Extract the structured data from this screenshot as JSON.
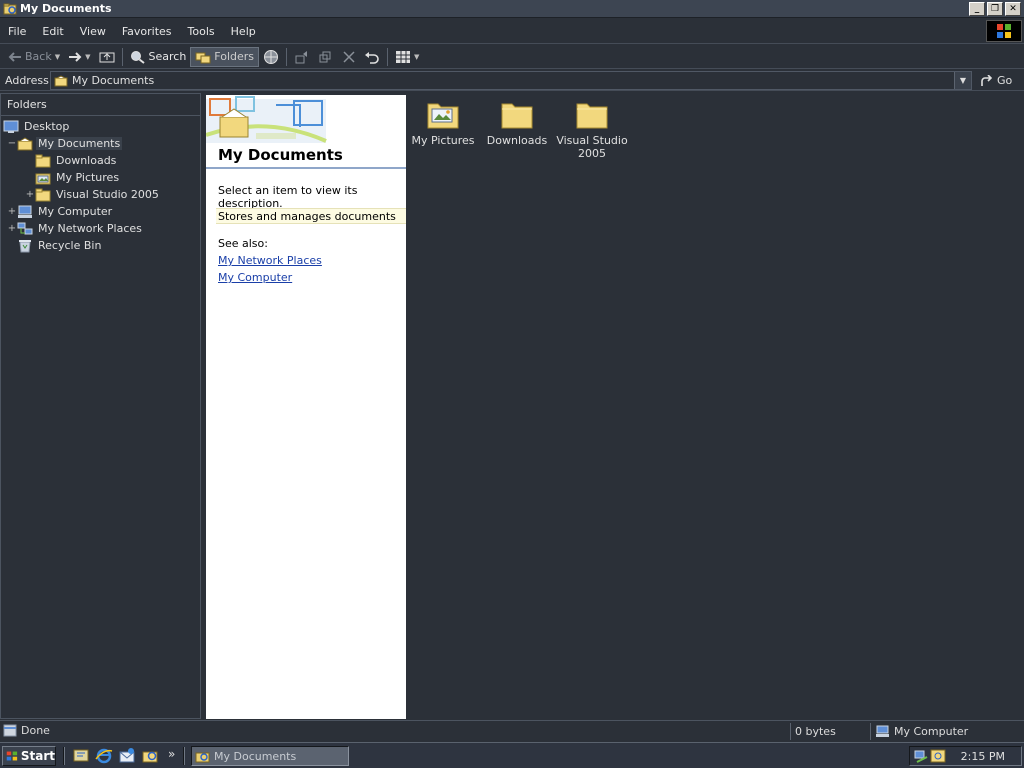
{
  "window": {
    "title": "My Documents",
    "controls": [
      "minimize",
      "restore",
      "close"
    ]
  },
  "menu": [
    "File",
    "Edit",
    "View",
    "Favorites",
    "Tools",
    "Help"
  ],
  "toolbar": {
    "back_label": "Back",
    "search_label": "Search",
    "folders_label": "Folders"
  },
  "address": {
    "label": "Address",
    "value": "My Documents",
    "go_label": "Go"
  },
  "folders_pane": {
    "header": "Folders",
    "items": [
      {
        "label": "Desktop",
        "level": 0,
        "icon": "desktop-icon",
        "expander": ""
      },
      {
        "label": "My Documents",
        "level": 1,
        "icon": "my-documents-icon",
        "expander": "−",
        "selected": true
      },
      {
        "label": "Downloads",
        "level": 2,
        "icon": "folder-icon",
        "expander": ""
      },
      {
        "label": "My Pictures",
        "level": 2,
        "icon": "pictures-folder-icon",
        "expander": ""
      },
      {
        "label": "Visual Studio 2005",
        "level": 2,
        "icon": "folder-icon",
        "expander": "+"
      },
      {
        "label": "My Computer",
        "level": 1,
        "icon": "computer-icon",
        "expander": "+"
      },
      {
        "label": "My Network Places",
        "level": 1,
        "icon": "network-icon",
        "expander": "+"
      },
      {
        "label": "Recycle Bin",
        "level": 1,
        "icon": "recycle-bin-icon",
        "expander": ""
      }
    ]
  },
  "task_pane": {
    "title": "My Documents",
    "description": "Select an item to view its description.",
    "stores": "Stores and manages documents",
    "see_also": "See also:",
    "links": [
      "My Network Places",
      "My Computer"
    ]
  },
  "files": [
    {
      "name": "My Pictures",
      "icon": "pictures-folder-icon"
    },
    {
      "name": "Downloads",
      "icon": "folder-icon"
    },
    {
      "name": "Visual Studio 2005",
      "icon": "folder-icon"
    }
  ],
  "status": {
    "text": "Done",
    "size": "0 bytes",
    "zone": "My Computer"
  },
  "taskbar": {
    "start_label": "Start",
    "window_button": "My Documents",
    "more_glyph": "»",
    "clock": "2:15 PM"
  },
  "colors": {
    "background": "#2b3038",
    "link": "#1a3fa8",
    "folder": "#f2d87e"
  }
}
